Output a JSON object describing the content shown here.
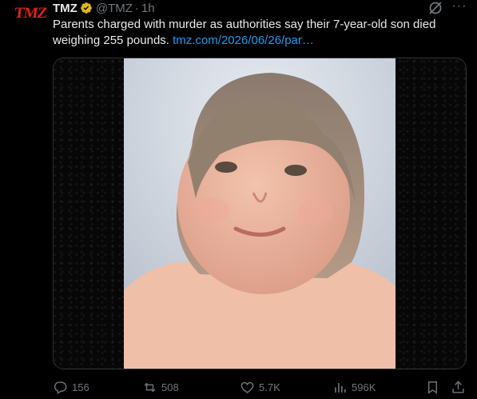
{
  "tweet": {
    "avatar_logo": "TMZ",
    "display_name": "TMZ",
    "handle": "@TMZ",
    "separator": "·",
    "time": "1h",
    "text": "Parents charged with murder as authorities say their 7-year-old son died weighing 255 pounds.",
    "link": "tmz.com/2026/06/26/par…",
    "more_label": "···"
  },
  "actions": {
    "replies": "156",
    "reposts": "508",
    "likes": "5.7K",
    "views": "596K"
  },
  "colors": {
    "accent": "#1d9bf0",
    "brand": "#e0201a",
    "muted": "#71767b",
    "verified": "#e2b719"
  }
}
